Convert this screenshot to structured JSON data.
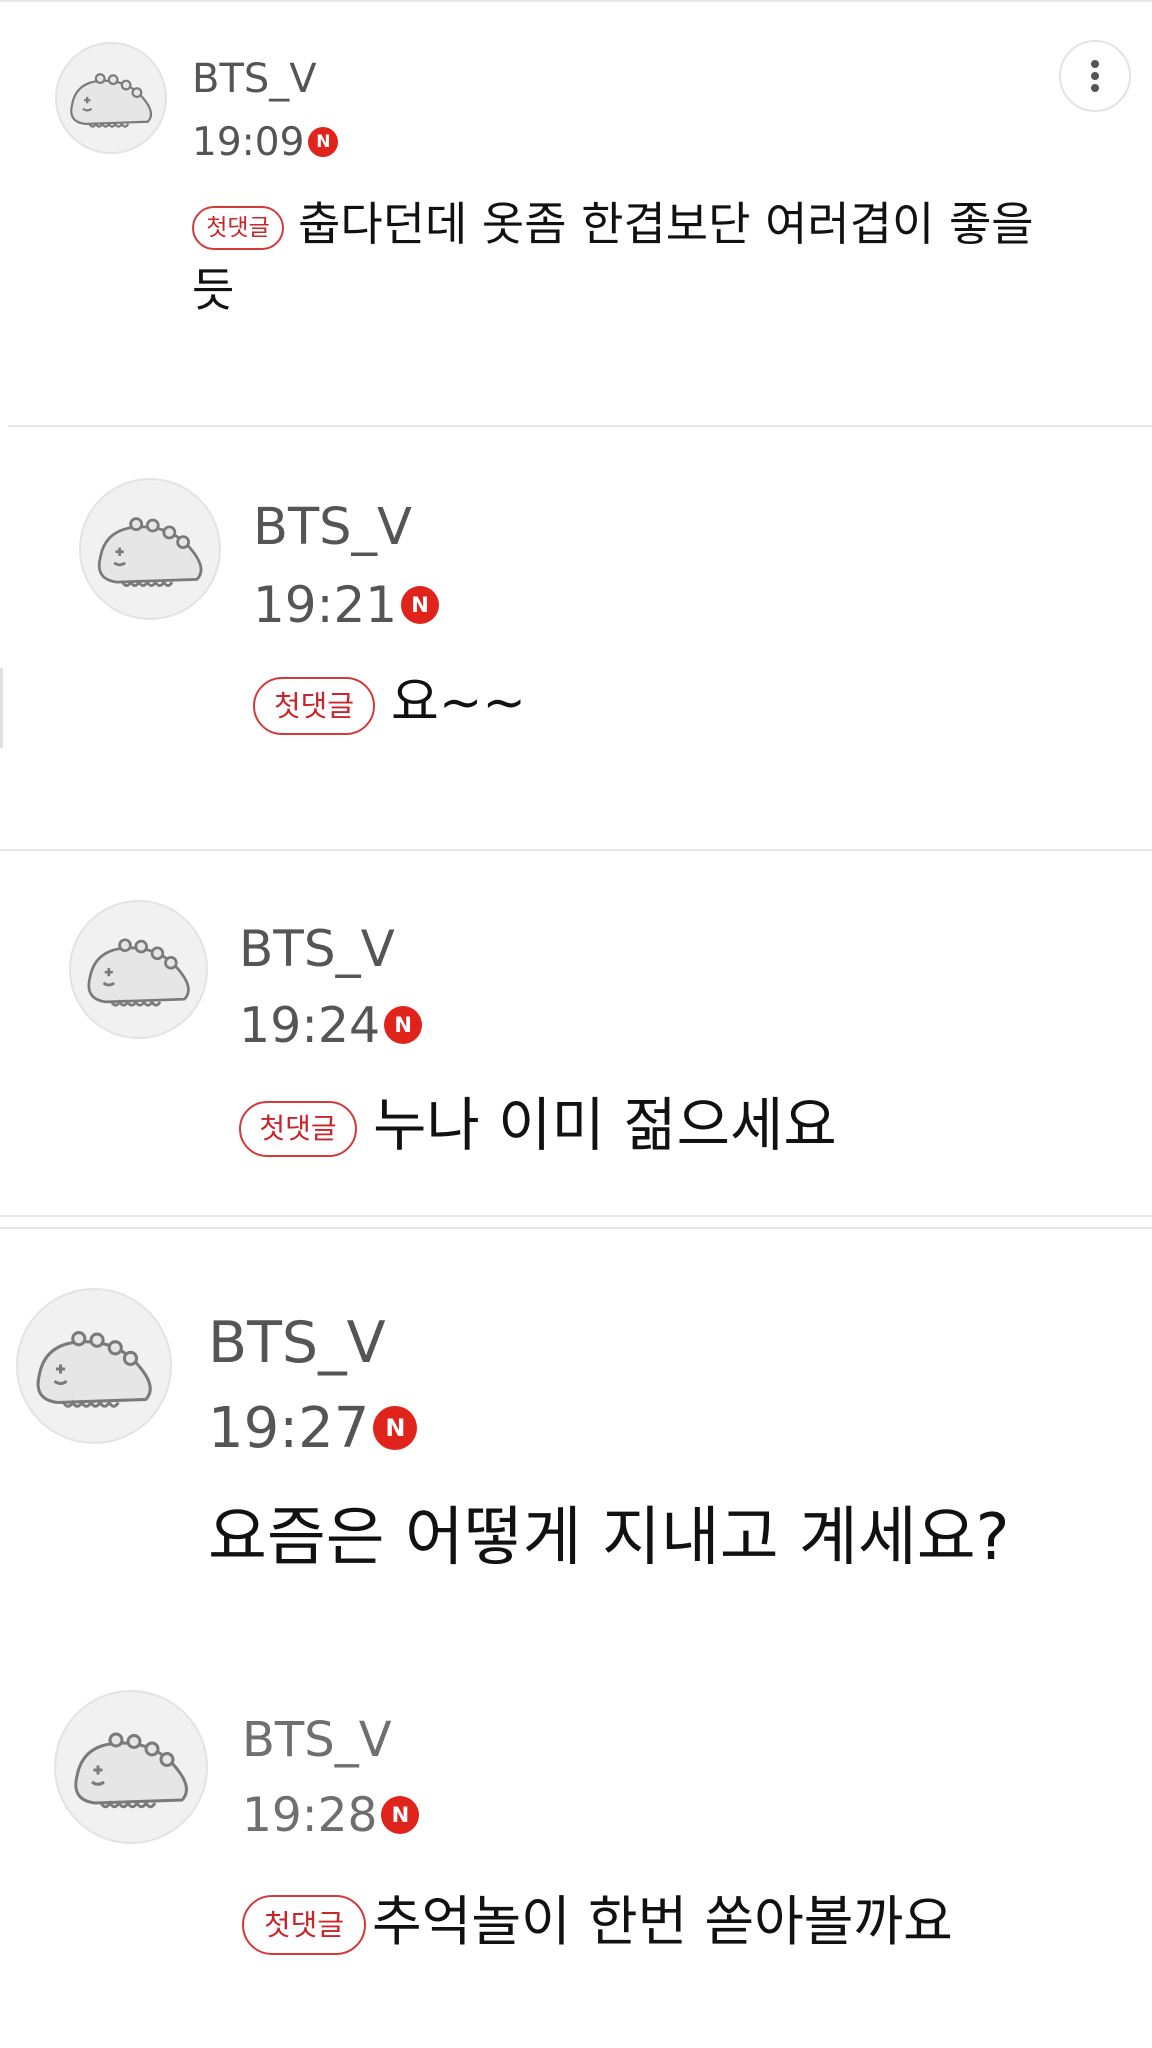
{
  "comments": [
    {
      "username": "BTS_V",
      "time": "19:09",
      "new_badge": "N",
      "first_badge": "첫댓글",
      "text": "춥다던데 옷좀 한겹보단 여러겹이 좋을",
      "text_line2": "듯"
    },
    {
      "username": "BTS_V",
      "time": "19:21",
      "new_badge": "N",
      "first_badge": "첫댓글",
      "text": "요~~"
    },
    {
      "username": "BTS_V",
      "time": "19:24",
      "new_badge": "N",
      "first_badge": "첫댓글",
      "text": "누나 이미 젊으세요"
    },
    {
      "username": "BTS_V",
      "time": "19:27",
      "new_badge": "N",
      "text": "요즘은 어떻게 지내고 계세요?"
    },
    {
      "username": "BTS_V",
      "time": "19:28",
      "new_badge": "N",
      "first_badge": "첫댓글",
      "text": "추억놀이 한번 쏟아볼까요"
    }
  ],
  "icons": {
    "avatar": "dinosaur-avatar-icon",
    "more": "more-vertical-icon"
  },
  "colors": {
    "badge_red": "#e0231b",
    "first_comment_red": "#c8262a",
    "divider": "#e6e6e6"
  }
}
